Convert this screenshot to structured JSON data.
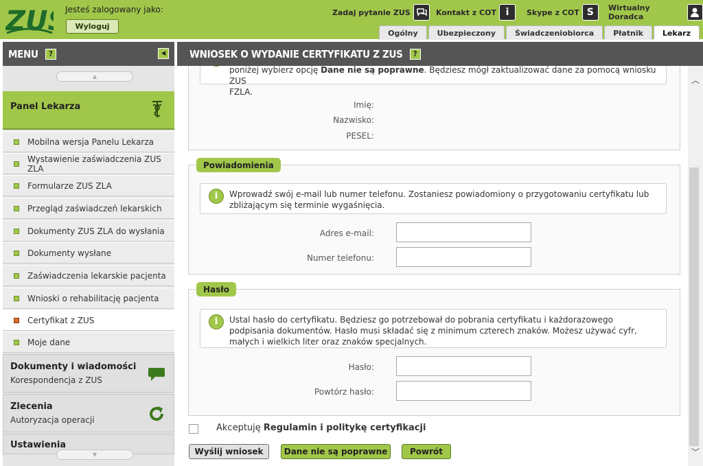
{
  "header": {
    "logo_text": "ZUS",
    "logged_in_label": "Jesteś zalogowany jako:",
    "logout_label": "Wyloguj",
    "links": [
      {
        "label": "Zadaj pytanie ZUS",
        "icon": "chat-icon"
      },
      {
        "label": "Kontakt z COT",
        "icon": "info-icon"
      },
      {
        "label": "Skype z COT",
        "icon": "skype-icon"
      },
      {
        "label": "Wirtualny Doradca",
        "icon": "person-icon"
      }
    ],
    "tabs": [
      "Ogólny",
      "Ubezpieczony",
      "Świadczeniobiorca",
      "Płatnik",
      "Lekarz"
    ],
    "active_tab": "Lekarz"
  },
  "sidebar": {
    "menu_title": "MENU",
    "help_glyph": "?",
    "panel_title": "Panel Lekarza",
    "items": [
      "Mobilna wersja Panelu Lekarza",
      "Wystawienie zaświadczenia ZUS ZLA",
      "Formularze ZUS ZLA",
      "Przegląd zaświadczeń lekarskich",
      "Dokumenty ZUS ZLA do wysłania",
      "Dokumenty wysłane",
      "Zaświadczenia lekarskie pacjenta",
      "Wnioski o rehabilitację pacjenta",
      "Certyfikat z ZUS",
      "Moje dane"
    ],
    "active_item": "Certyfikat z ZUS",
    "sections": [
      {
        "title": "Dokumenty i wiadomości",
        "subtitle": "Korespondencja z ZUS",
        "icon": "speech-bubble-icon"
      },
      {
        "title": "Zlecenia",
        "subtitle": "Autoryzacja operacji",
        "icon": "refresh-icon"
      }
    ],
    "cut_off_section": "Ustawienia"
  },
  "main": {
    "title": "WNIOSEK O WYDANIE CERTYFIKATU Z ZUS",
    "top_info_line1_pre": "poniżej wybierz opcję ",
    "top_info_line1_bold": "Dane nie są poprawne",
    "top_info_line1_post": ". Będziesz mógł zaktualizować dane za pomocą wniosku ZUS",
    "top_info_line2": "FZLA.",
    "identity_fields": [
      "Imię:",
      "Nazwisko:",
      "PESEL:"
    ],
    "notifications": {
      "legend": "Powiadomienia",
      "info": "Wprowadź swój e-mail lub numer telefonu. Zostaniesz powiadomiony o przygotowaniu certyfikatu lub zbliżającym się terminie wygaśnięcia.",
      "email_label": "Adres e-mail:",
      "phone_label": "Numer telefonu:",
      "email_value": "",
      "phone_value": ""
    },
    "password": {
      "legend": "Hasło",
      "info": "Ustal hasło do certyfikatu. Będziesz go potrzebował do pobrania certyfikatu i każdorazowego podpisania dokumentów. Hasło musi składać się z minimum czterech znaków. Możesz używać cyfr, małych i wielkich liter oraz znaków specjalnych.",
      "password_label": "Hasło:",
      "repeat_label": "Powtórz hasło:"
    },
    "accept_pre": "Akceptuję ",
    "accept_bold": "Regulamin i politykę certyfikacji",
    "buttons": {
      "send": "Wyślij wniosek",
      "incorrect": "Dane nie są poprawne",
      "back": "Powrót"
    }
  },
  "colors": {
    "brand_green": "#a1c74a",
    "dark_header": "#555555",
    "logo_green": "#1f6b2a"
  }
}
